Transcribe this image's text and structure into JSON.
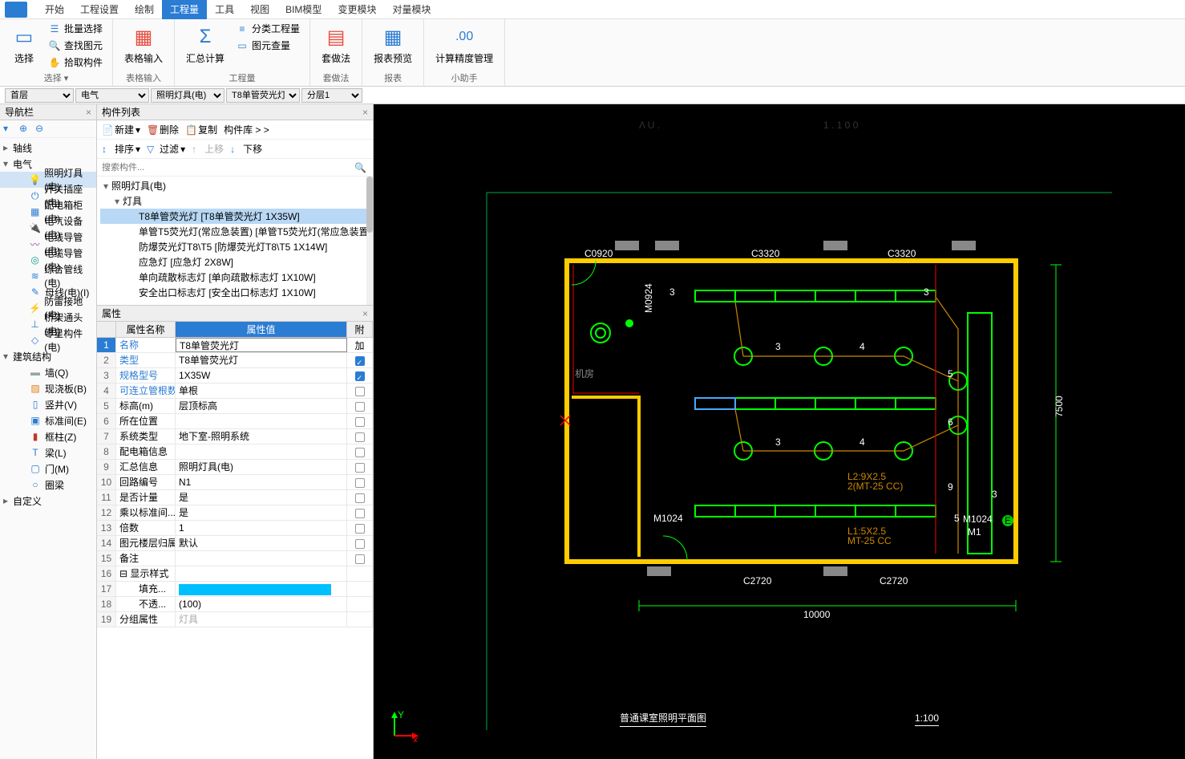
{
  "menubar": {
    "items": [
      "开始",
      "工程设置",
      "绘制",
      "工程量",
      "工具",
      "视图",
      "BIM模型",
      "变更模块",
      "对量模块"
    ],
    "active_index": 3
  },
  "ribbon": {
    "groups": [
      {
        "label": "选择 ▾",
        "big": {
          "label": "选择",
          "icon": "⬚"
        },
        "small": [
          {
            "label": "批量选择",
            "icon": "☰"
          },
          {
            "label": "查找图元",
            "icon": "🔍"
          },
          {
            "label": "拾取构件",
            "icon": "✋"
          }
        ]
      },
      {
        "label": "表格输入",
        "big": {
          "label": "表格输入",
          "icon": "▦"
        }
      },
      {
        "label": "工程量",
        "big": {
          "label": "汇总计算",
          "icon": "Σ"
        },
        "small": [
          {
            "label": "分类工程量",
            "icon": "≡"
          },
          {
            "label": "图元查量",
            "icon": "▭"
          }
        ]
      },
      {
        "label": "套做法",
        "big": {
          "label": "套做法",
          "icon": "▤"
        }
      },
      {
        "label": "报表",
        "big": {
          "label": "报表预览",
          "icon": "▦"
        }
      },
      {
        "label": "小助手",
        "big": {
          "label": "计算精度管理",
          "icon": ".00"
        }
      }
    ]
  },
  "filterbar": {
    "floor": "首层",
    "category": "电气",
    "subcategory": "照明灯具(电)",
    "component": "T8单管荧光灯",
    "layer": "分层1"
  },
  "nav": {
    "title": "导航栏",
    "groups": [
      {
        "name": "轴线",
        "exp": "▸",
        "children": []
      },
      {
        "name": "电气",
        "exp": "▾",
        "children": [
          {
            "name": "照明灯具(电)",
            "icon": "💡",
            "selected": true
          },
          {
            "name": "开关插座(电)",
            "icon": "⏻"
          },
          {
            "name": "配电箱柜(电)",
            "icon": "▦"
          },
          {
            "name": "电气设备(电)",
            "icon": "🔌"
          },
          {
            "name": "电线导管(电)",
            "icon": "〰"
          },
          {
            "name": "电缆导管(电)",
            "icon": "◎"
          },
          {
            "name": "综合管线(电)",
            "icon": "≋"
          },
          {
            "name": "母线(电)(I)",
            "icon": "✎"
          },
          {
            "name": "防雷接地(电)",
            "icon": "⚡"
          },
          {
            "name": "桥架通头(电)",
            "icon": "⊥"
          },
          {
            "name": "零星构件(电)",
            "icon": "◇"
          }
        ]
      },
      {
        "name": "建筑结构",
        "exp": "▾",
        "children": [
          {
            "name": "墙(Q)",
            "icon": "▬"
          },
          {
            "name": "现浇板(B)",
            "icon": "▨"
          },
          {
            "name": "竖井(V)",
            "icon": "▯"
          },
          {
            "name": "标准间(E)",
            "icon": "▣"
          },
          {
            "name": "框柱(Z)",
            "icon": "▮"
          },
          {
            "name": "梁(L)",
            "icon": "T"
          },
          {
            "name": "门(M)",
            "icon": "▢"
          },
          {
            "name": "圈梁",
            "icon": "○"
          }
        ]
      },
      {
        "name": "自定义",
        "exp": "▸",
        "children": []
      }
    ]
  },
  "complist": {
    "title": "构件列表",
    "toolbar1": {
      "new": "新建",
      "delete": "删除",
      "copy": "复制",
      "lib": "构件库 > >"
    },
    "toolbar2": {
      "sort": "排序",
      "filter": "过滤",
      "up": "上移",
      "down": "下移"
    },
    "search_placeholder": "搜索构件...",
    "tree": {
      "root": "照明灯具(电)",
      "group": "灯具",
      "items": [
        {
          "name": "T8单管荧光灯 [T8单管荧光灯 1X35W]",
          "selected": true
        },
        {
          "name": "单管T5荧光灯(常应急装置) [单管T5荧光灯(常应急装置"
        },
        {
          "name": "防爆荧光灯T8\\T5 [防爆荧光灯T8\\T5 1X14W]"
        },
        {
          "name": "应急灯 [应急灯 2X8W]"
        },
        {
          "name": "单向疏散标志灯 [单向疏散标志灯 1X10W]"
        },
        {
          "name": "安全出口标志灯 [安全出口标志灯 1X10W]"
        }
      ]
    }
  },
  "props": {
    "title": "属性",
    "header": {
      "name": "属性名称",
      "value": "属性值",
      "add": "附加"
    },
    "rows": [
      {
        "n": 1,
        "name": "名称",
        "value": "T8单管荧光灯",
        "link": true,
        "selected": true
      },
      {
        "n": 2,
        "name": "类型",
        "value": "T8单管荧光灯",
        "link": true,
        "checked": true
      },
      {
        "n": 3,
        "name": "规格型号",
        "value": "1X35W",
        "link": true,
        "checked": true
      },
      {
        "n": 4,
        "name": "可连立管根数",
        "value": "单根",
        "link": true,
        "checked": false
      },
      {
        "n": 5,
        "name": "标高(m)",
        "value": "层顶标高",
        "checked": false
      },
      {
        "n": 6,
        "name": "所在位置",
        "value": "",
        "checked": false
      },
      {
        "n": 7,
        "name": "系统类型",
        "value": "地下室-照明系统",
        "checked": false
      },
      {
        "n": 8,
        "name": "配电箱信息",
        "value": "",
        "checked": false
      },
      {
        "n": 9,
        "name": "汇总信息",
        "value": "照明灯具(电)",
        "checked": false
      },
      {
        "n": 10,
        "name": "回路编号",
        "value": "N1",
        "checked": false
      },
      {
        "n": 11,
        "name": "是否计量",
        "value": "是",
        "checked": false
      },
      {
        "n": 12,
        "name": "乘以标准间...",
        "value": "是",
        "checked": false
      },
      {
        "n": 13,
        "name": "倍数",
        "value": "1",
        "checked": false
      },
      {
        "n": 14,
        "name": "图元楼层归属",
        "value": "默认",
        "checked": false
      },
      {
        "n": 15,
        "name": "备注",
        "value": "",
        "checked": false
      },
      {
        "n": 16,
        "name": "⊟ 显示样式",
        "value": ""
      },
      {
        "n": 17,
        "name": "　　填充...",
        "value": "",
        "swatch": true
      },
      {
        "n": 18,
        "name": "　　不透...",
        "value": "(100)"
      },
      {
        "n": 19,
        "name": "分组属性",
        "value": "灯具",
        "gray": true
      }
    ]
  },
  "canvas": {
    "labels": {
      "c0920": "C0920",
      "c3320a": "C3320",
      "c3320b": "C3320",
      "m0924": "M0924",
      "m1024a": "M1024",
      "m1024b": "M1024",
      "m1": "M1",
      "c2720a": "C2720",
      "c2720b": "C2720",
      "dim_h": "10000",
      "dim_v": "7500",
      "n3a": "3",
      "n3b": "3",
      "n4a": "4",
      "n3c": "3",
      "n3d": "3",
      "n4b": "4",
      "n5": "5",
      "n6": "6",
      "n9": "9",
      "n5b": "5",
      "n3e": "3",
      "l1": "L2:9X2.5",
      "l2": "2(MT-25 CC)",
      "l3": "L1:5X2.5",
      "l4": "MT-25 CC",
      "room": "机房"
    },
    "title": "普通课室照明平面图",
    "scale": "1:100"
  }
}
